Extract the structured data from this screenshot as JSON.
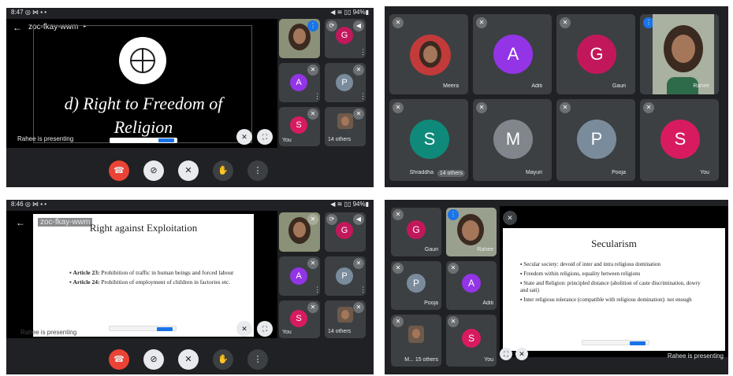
{
  "panel1": {
    "status_time": "8:47",
    "status_left_icons": "◎ ⋈ ▪ •",
    "status_right": "◀ ≋ ▯▯ 94%▮",
    "meeting_code": "zoc-fkay-wwm",
    "slide_title": "d) Right to Freedom of Religion",
    "presenting_label": "Rahee is presenting",
    "tiles": [
      {
        "initial": "",
        "name": ""
      },
      {
        "initial": "G",
        "name": ""
      },
      {
        "initial": "A",
        "name": ""
      },
      {
        "initial": "P",
        "name": ""
      },
      {
        "initial": "S",
        "name": "You"
      },
      {
        "initial": "",
        "name": "14 others"
      }
    ]
  },
  "panel2": {
    "tiles": [
      {
        "initial": "",
        "name": "Meera"
      },
      {
        "initial": "A",
        "name": "Aditi"
      },
      {
        "initial": "G",
        "name": "Gauri"
      },
      {
        "initial": "",
        "name": "Rahee"
      },
      {
        "initial": "S",
        "name": "Shraddha",
        "extra": "14 others"
      },
      {
        "initial": "M",
        "name": "Mayuri"
      },
      {
        "initial": "P",
        "name": "Pooja"
      },
      {
        "initial": "S",
        "name": "You"
      }
    ]
  },
  "panel3": {
    "status_time": "8:46",
    "status_left_icons": "◎ ⋈ ▪ •",
    "status_right": "◀ ≋ ▯▯ 94%▮",
    "meeting_code": "zoc-fkay-wwm",
    "doc_title": "Right against Exploitation",
    "doc_items": [
      {
        "bold": "Article 23:",
        "text": " Prohibition of traffic in human beings and forced labour"
      },
      {
        "bold": "Article 24:",
        "text": " Prohibition of employment of children in factories etc."
      }
    ],
    "presenting_label": "Rahee is presenting",
    "tiles": [
      {
        "initial": "",
        "name": ""
      },
      {
        "initial": "G",
        "name": ""
      },
      {
        "initial": "A",
        "name": ""
      },
      {
        "initial": "P",
        "name": ""
      },
      {
        "initial": "S",
        "name": "You"
      },
      {
        "initial": "",
        "name": "14 others"
      }
    ]
  },
  "panel4": {
    "doc_title": "Secularism",
    "doc_items": [
      "Secular society: devoid of inter and intra religious domination",
      "Freedom within religions, equality between religions",
      "State and Religion: principled distance (abolition of caste discrimination, dowry and sati)",
      "Inter religious tolerance (compatible with religious domination): not enough"
    ],
    "presenting_label": "Rahee is presenting",
    "tiles": [
      {
        "initial": "G",
        "name": "Gauri"
      },
      {
        "initial": "",
        "name": "Rahee"
      },
      {
        "initial": "P",
        "name": "Pooja"
      },
      {
        "initial": "A",
        "name": "Aditi"
      },
      {
        "initial": "",
        "name": "M... 15 others"
      },
      {
        "initial": "S",
        "name": "You"
      }
    ]
  },
  "colors": {
    "background": "#202124",
    "tile": "#3c4043",
    "end_call": "#ea4335",
    "avatar_G": "#c2185b",
    "avatar_A": "#9334e6",
    "avatar_P": "#7a8b9c",
    "avatar_S": "#d81b60",
    "avatar_M": "#80868b",
    "avatar_S_teal": "#0f8a7a",
    "accent": "#1a73e8"
  },
  "icons": [
    "back-arrow-icon",
    "mic-off-icon",
    "camera-off-icon",
    "hand-raise-icon",
    "more-options-icon",
    "end-call-icon",
    "camera-switch-icon",
    "speaker-icon",
    "expand-icon",
    "globe-icon"
  ]
}
